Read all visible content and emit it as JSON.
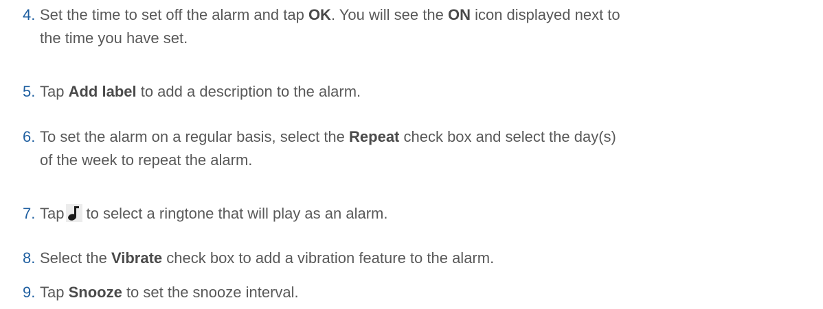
{
  "steps": [
    {
      "number": "4.",
      "line1_pre": "Set the time to set off the alarm and tap ",
      "bold1": "OK",
      "line1_mid": ". You will see the ",
      "bold2": "ON",
      "line1_post": " icon displayed next to",
      "line2": "the time you have set."
    },
    {
      "number": "5.",
      "pre": "Tap ",
      "bold": "Add label",
      "post": " to add a description to the alarm."
    },
    {
      "number": "6.",
      "line1_pre": "To set the alarm on a regular basis, select the ",
      "bold": "Repeat",
      "line1_post": " check box and select the day(s)",
      "line2": "of the week to repeat the alarm."
    },
    {
      "number": "7.",
      "pre": "Tap",
      "icon": "music-note-icon",
      "post": "to select a ringtone that will play as an alarm."
    },
    {
      "number": "8.",
      "pre": "Select the ",
      "bold": "Vibrate",
      "post": " check box to add a vibration feature to the alarm."
    },
    {
      "number": "9.",
      "pre": "Tap ",
      "bold": "Snooze",
      "post": " to set the snooze interval."
    }
  ]
}
